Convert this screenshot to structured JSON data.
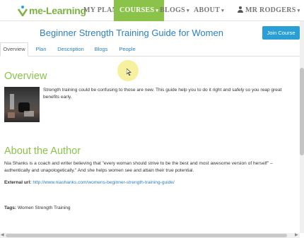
{
  "nav": {
    "logo_text": "me-Learning",
    "items": [
      {
        "label": "MY PLAN"
      },
      {
        "label": "COURSES"
      },
      {
        "label": "BLOGS"
      },
      {
        "label": "ABOUT"
      }
    ],
    "user_label": "MR RODGERS",
    "caret": "▾",
    "active_color": "#8bc34a"
  },
  "header": {
    "course_title": "Beginner Strength Training Guide for Women",
    "join_label": "Join Course"
  },
  "tabs": [
    {
      "label": "Overview",
      "active": true
    },
    {
      "label": "Plan"
    },
    {
      "label": "Description"
    },
    {
      "label": "Blogs"
    },
    {
      "label": "People"
    }
  ],
  "overview": {
    "heading": "Overview",
    "text": "Strength training could be confusing to those are new. This guide help you to do it right and safely so you reap great benefits early."
  },
  "author": {
    "heading": "About the Author",
    "bio": "Nia Shanks is a coach and writer believing that \"every woman should strive to be the best and most awesome version of herself\" – authentically and unapologetically.\" And she helps women see and attain their true potential.",
    "external_label": "External url:",
    "external_url": "http://www.niashanks.com/womens-beginner-strength-training-guide/"
  },
  "tags": {
    "label": "Tags:",
    "value": "Women Strength Training"
  },
  "colors": {
    "accent_green": "#8bc34a",
    "link_blue": "#2d7fc1",
    "button_blue": "#2a9fd6"
  }
}
